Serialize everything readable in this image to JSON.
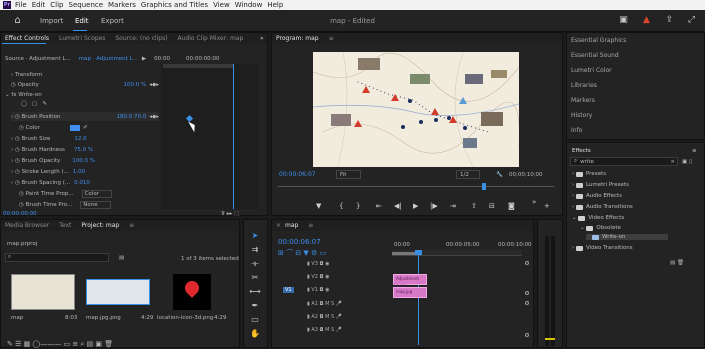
{
  "menu": {
    "items": [
      "File",
      "Edit",
      "Clip",
      "Sequence",
      "Markers",
      "Graphics and Titles",
      "View",
      "Window",
      "Help"
    ]
  },
  "header": {
    "home_label": "Home",
    "workspaces": [
      "Import",
      "Edit",
      "Export"
    ],
    "active_workspace": "Edit",
    "doc_title": "map - Edited"
  },
  "effect_controls": {
    "tabs": [
      "Effect Controls",
      "Lumetri Scopes",
      "Source: (no clips)",
      "Audio Clip Mixer: map"
    ],
    "source": "Source · Adjustment L...",
    "clip": "map · Adjustment L...",
    "timecode_left": "00:00",
    "timecode_mid": "00:00:00:00",
    "rows": [
      {
        "label": "Transform",
        "value": ""
      },
      {
        "label": "Opacity",
        "value": "100.0 %"
      },
      {
        "label": "Write-on",
        "value": ""
      },
      {
        "label": "Brush Position",
        "value": "180.0   70.0"
      },
      {
        "label": "Color",
        "value": ""
      },
      {
        "label": "Brush Size",
        "value": "12.0"
      },
      {
        "label": "Brush Hardness",
        "value": "75.0 %"
      },
      {
        "label": "Brush Opacity",
        "value": "100.0 %"
      },
      {
        "label": "Stroke Length (...",
        "value": "1.00"
      },
      {
        "label": "Brush Spacing (...",
        "value": "0.010"
      },
      {
        "label": "Paint Time Prop...",
        "value": "Color"
      },
      {
        "label": "Brush Time Pro...",
        "value": "None"
      }
    ],
    "footer_time": "00:00:00:00"
  },
  "program": {
    "title": "Program: map",
    "timecode": "00:00:06;07",
    "fit": "Fit",
    "quality": "1/2",
    "duration": "00;00;10;00"
  },
  "project": {
    "tabs": [
      "Media Browser",
      "Text",
      "Project: map"
    ],
    "file": "map.prproj",
    "search_placeholder": "",
    "count": "1 of 3 items selected",
    "items": [
      {
        "name": "map",
        "dur": "8:03"
      },
      {
        "name": "map.jpg.png",
        "dur": "4:29"
      },
      {
        "name": "location-icon-3d.png",
        "dur": "4:29"
      }
    ]
  },
  "timeline": {
    "title": "map",
    "timecode": "00:00:06:07",
    "ruler": [
      "00:00",
      "00:00:05:00",
      "00:00:10:00"
    ],
    "tracks": [
      "V3",
      "V2",
      "V1",
      "A1",
      "A2",
      "A3"
    ],
    "clip_labels": [
      "Adjustment Layer",
      "map.jpg"
    ]
  },
  "workspaces": [
    "Essential Graphics",
    "Essential Sound",
    "Lumetri Color",
    "Libraries",
    "Markers",
    "History",
    "Info"
  ],
  "effects": {
    "title": "Effects",
    "search": "write",
    "tree": [
      "Presets",
      "Lumetri Presets",
      "Audio Effects",
      "Audio Transitions",
      "Video Effects",
      "Obsolete",
      "Write-on",
      "Video Transitions"
    ]
  }
}
